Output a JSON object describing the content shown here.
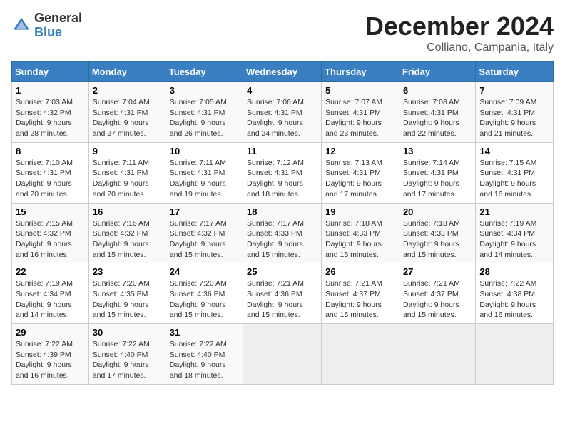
{
  "logo": {
    "general": "General",
    "blue": "Blue"
  },
  "title": "December 2024",
  "location": "Colliano, Campania, Italy",
  "days_of_week": [
    "Sunday",
    "Monday",
    "Tuesday",
    "Wednesday",
    "Thursday",
    "Friday",
    "Saturday"
  ],
  "weeks": [
    [
      {
        "day": "1",
        "sunrise": "7:03 AM",
        "sunset": "4:32 PM",
        "daylight": "9 hours and 28 minutes."
      },
      {
        "day": "2",
        "sunrise": "7:04 AM",
        "sunset": "4:31 PM",
        "daylight": "9 hours and 27 minutes."
      },
      {
        "day": "3",
        "sunrise": "7:05 AM",
        "sunset": "4:31 PM",
        "daylight": "9 hours and 26 minutes."
      },
      {
        "day": "4",
        "sunrise": "7:06 AM",
        "sunset": "4:31 PM",
        "daylight": "9 hours and 24 minutes."
      },
      {
        "day": "5",
        "sunrise": "7:07 AM",
        "sunset": "4:31 PM",
        "daylight": "9 hours and 23 minutes."
      },
      {
        "day": "6",
        "sunrise": "7:08 AM",
        "sunset": "4:31 PM",
        "daylight": "9 hours and 22 minutes."
      },
      {
        "day": "7",
        "sunrise": "7:09 AM",
        "sunset": "4:31 PM",
        "daylight": "9 hours and 21 minutes."
      }
    ],
    [
      {
        "day": "8",
        "sunrise": "7:10 AM",
        "sunset": "4:31 PM",
        "daylight": "9 hours and 20 minutes."
      },
      {
        "day": "9",
        "sunrise": "7:11 AM",
        "sunset": "4:31 PM",
        "daylight": "9 hours and 20 minutes."
      },
      {
        "day": "10",
        "sunrise": "7:11 AM",
        "sunset": "4:31 PM",
        "daylight": "9 hours and 19 minutes."
      },
      {
        "day": "11",
        "sunrise": "7:12 AM",
        "sunset": "4:31 PM",
        "daylight": "9 hours and 18 minutes."
      },
      {
        "day": "12",
        "sunrise": "7:13 AM",
        "sunset": "4:31 PM",
        "daylight": "9 hours and 17 minutes."
      },
      {
        "day": "13",
        "sunrise": "7:14 AM",
        "sunset": "4:31 PM",
        "daylight": "9 hours and 17 minutes."
      },
      {
        "day": "14",
        "sunrise": "7:15 AM",
        "sunset": "4:31 PM",
        "daylight": "9 hours and 16 minutes."
      }
    ],
    [
      {
        "day": "15",
        "sunrise": "7:15 AM",
        "sunset": "4:32 PM",
        "daylight": "9 hours and 16 minutes."
      },
      {
        "day": "16",
        "sunrise": "7:16 AM",
        "sunset": "4:32 PM",
        "daylight": "9 hours and 15 minutes."
      },
      {
        "day": "17",
        "sunrise": "7:17 AM",
        "sunset": "4:32 PM",
        "daylight": "9 hours and 15 minutes."
      },
      {
        "day": "18",
        "sunrise": "7:17 AM",
        "sunset": "4:33 PM",
        "daylight": "9 hours and 15 minutes."
      },
      {
        "day": "19",
        "sunrise": "7:18 AM",
        "sunset": "4:33 PM",
        "daylight": "9 hours and 15 minutes."
      },
      {
        "day": "20",
        "sunrise": "7:18 AM",
        "sunset": "4:33 PM",
        "daylight": "9 hours and 15 minutes."
      },
      {
        "day": "21",
        "sunrise": "7:19 AM",
        "sunset": "4:34 PM",
        "daylight": "9 hours and 14 minutes."
      }
    ],
    [
      {
        "day": "22",
        "sunrise": "7:19 AM",
        "sunset": "4:34 PM",
        "daylight": "9 hours and 14 minutes."
      },
      {
        "day": "23",
        "sunrise": "7:20 AM",
        "sunset": "4:35 PM",
        "daylight": "9 hours and 15 minutes."
      },
      {
        "day": "24",
        "sunrise": "7:20 AM",
        "sunset": "4:36 PM",
        "daylight": "9 hours and 15 minutes."
      },
      {
        "day": "25",
        "sunrise": "7:21 AM",
        "sunset": "4:36 PM",
        "daylight": "9 hours and 15 minutes."
      },
      {
        "day": "26",
        "sunrise": "7:21 AM",
        "sunset": "4:37 PM",
        "daylight": "9 hours and 15 minutes."
      },
      {
        "day": "27",
        "sunrise": "7:21 AM",
        "sunset": "4:37 PM",
        "daylight": "9 hours and 15 minutes."
      },
      {
        "day": "28",
        "sunrise": "7:22 AM",
        "sunset": "4:38 PM",
        "daylight": "9 hours and 16 minutes."
      }
    ],
    [
      {
        "day": "29",
        "sunrise": "7:22 AM",
        "sunset": "4:39 PM",
        "daylight": "9 hours and 16 minutes."
      },
      {
        "day": "30",
        "sunrise": "7:22 AM",
        "sunset": "4:40 PM",
        "daylight": "9 hours and 17 minutes."
      },
      {
        "day": "31",
        "sunrise": "7:22 AM",
        "sunset": "4:40 PM",
        "daylight": "9 hours and 18 minutes."
      },
      null,
      null,
      null,
      null
    ]
  ],
  "labels": {
    "sunrise": "Sunrise:",
    "sunset": "Sunset:",
    "daylight": "Daylight:"
  }
}
